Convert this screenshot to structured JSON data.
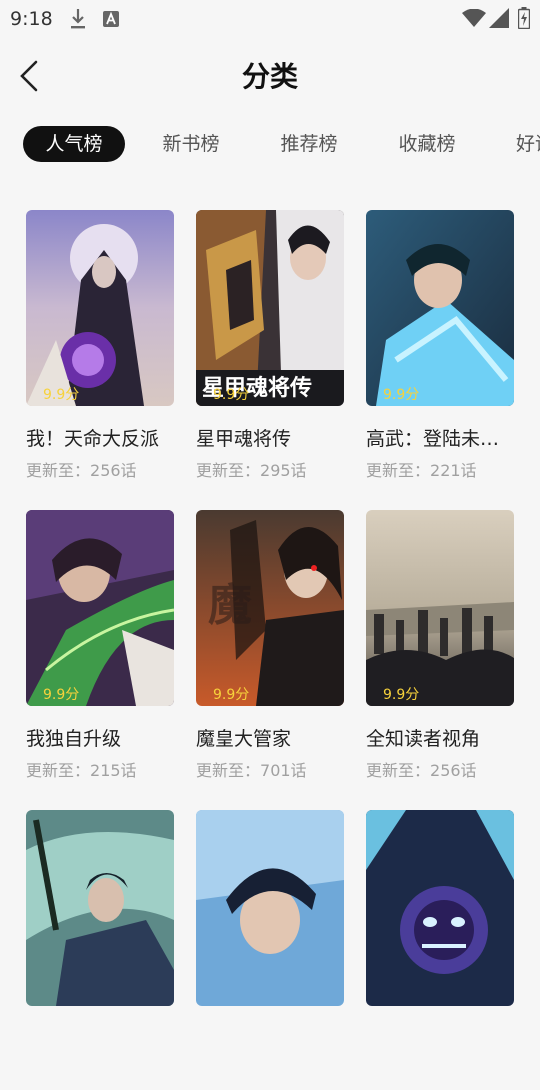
{
  "status_bar": {
    "time": "9:18"
  },
  "header": {
    "title": "分类"
  },
  "tabs": [
    {
      "label": "人气榜",
      "active": true
    },
    {
      "label": "新书榜",
      "active": false
    },
    {
      "label": "推荐榜",
      "active": false
    },
    {
      "label": "收藏榜",
      "active": false
    },
    {
      "label": "好评",
      "active": false
    }
  ],
  "update_prefix": "更新至：",
  "comics": [
    {
      "title": "我！天命大反派",
      "score": "9.9分",
      "chapter": "256话"
    },
    {
      "title": "星甲魂将传",
      "score": "9.9分",
      "chapter": "295话"
    },
    {
      "title": "高武：登陆未来一万年",
      "score": "9.9分",
      "chapter": "221话"
    },
    {
      "title": "我独自升级",
      "score": "9.9分",
      "chapter": "215话"
    },
    {
      "title": "魔皇大管家",
      "score": "9.9分",
      "chapter": "701话"
    },
    {
      "title": "全知读者视角",
      "score": "9.9分",
      "chapter": "256话"
    },
    {
      "title": "",
      "score": "",
      "chapter": ""
    },
    {
      "title": "",
      "score": "",
      "chapter": ""
    },
    {
      "title": "",
      "score": "",
      "chapter": ""
    }
  ],
  "colors": {
    "accent": "#111111",
    "score": "#f7d23b",
    "muted": "#a0a0a0"
  }
}
